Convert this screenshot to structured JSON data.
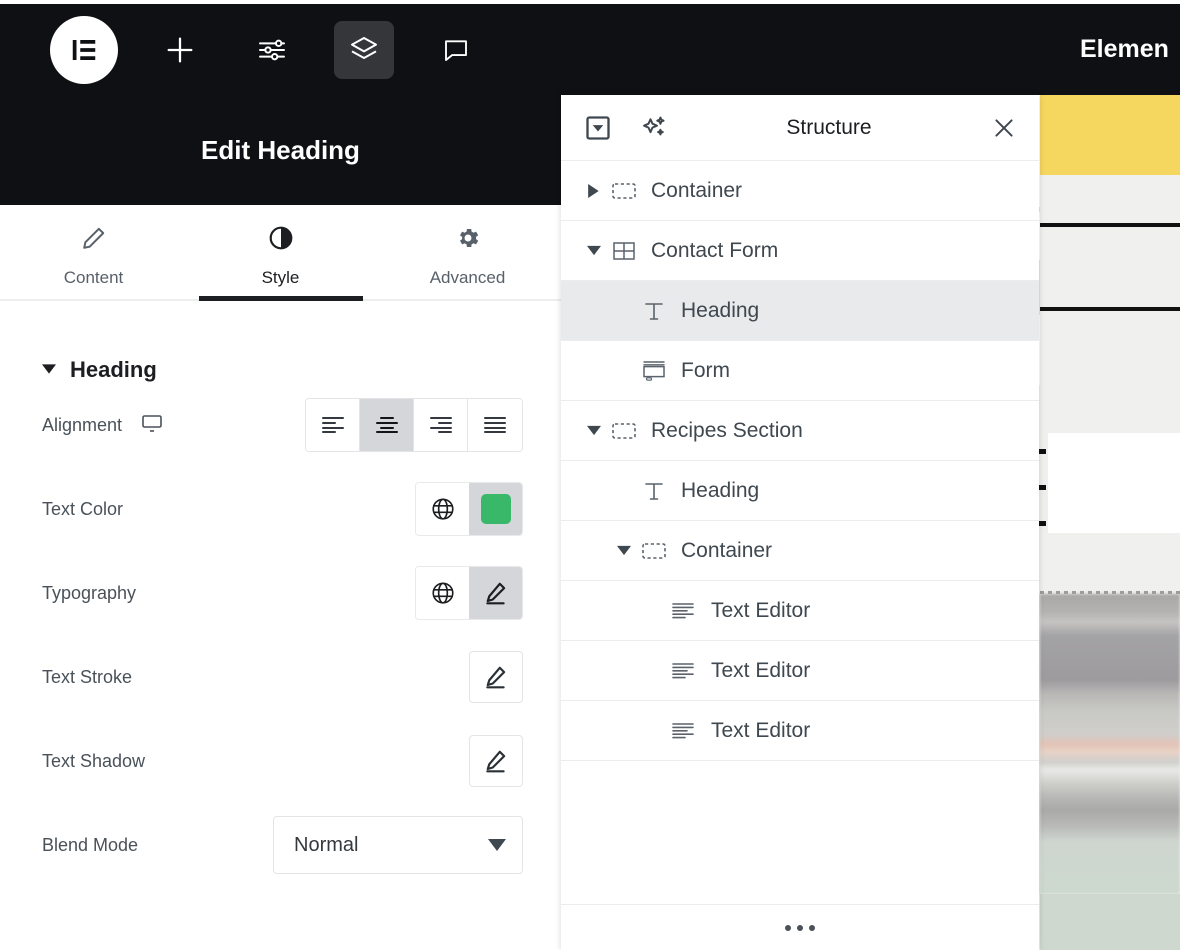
{
  "app": {
    "brand": "Elementor",
    "topbar_title": "Elemen"
  },
  "topbar": {
    "logo_icon": "elementor-logo-icon",
    "buttons": [
      {
        "name": "add-element-button",
        "icon": "plus-icon",
        "label": "Add Element",
        "active": false
      },
      {
        "name": "site-settings-button",
        "icon": "sliders-icon",
        "label": "Site Settings",
        "active": false
      },
      {
        "name": "structure-button",
        "icon": "layers-icon",
        "label": "Structure",
        "active": true
      },
      {
        "name": "notes-button",
        "icon": "comment-icon",
        "label": "Notes",
        "active": false
      }
    ]
  },
  "left_panel": {
    "header_title": "Edit Heading",
    "tabs": [
      {
        "label": "Content",
        "icon": "pencil-icon",
        "active": false
      },
      {
        "label": "Style",
        "icon": "contrast-icon",
        "active": true
      },
      {
        "label": "Advanced",
        "icon": "gear-icon",
        "active": false
      }
    ],
    "section": {
      "title": "Heading",
      "collapsed": false,
      "toggle_icon": "caret-down-icon"
    },
    "controls": {
      "alignment": {
        "label": "Alignment",
        "device_icon": "desktop-icon",
        "options": [
          {
            "value": "left",
            "icon": "align-left-icon",
            "active": false
          },
          {
            "value": "center",
            "icon": "align-center-icon",
            "active": true
          },
          {
            "value": "right",
            "icon": "align-right-icon",
            "active": false
          },
          {
            "value": "justify",
            "icon": "align-justify-icon",
            "active": false
          }
        ]
      },
      "text_color": {
        "label": "Text Color",
        "global_icon": "globe-icon",
        "swatch_color": "#3ab86a"
      },
      "typography": {
        "label": "Typography",
        "global_icon": "globe-icon",
        "edit_icon": "pencil-icon"
      },
      "text_stroke": {
        "label": "Text Stroke",
        "edit_icon": "pencil-icon"
      },
      "text_shadow": {
        "label": "Text Shadow",
        "edit_icon": "pencil-icon"
      },
      "blend_mode": {
        "label": "Blend Mode",
        "value": "Normal",
        "caret_icon": "caret-down-icon"
      }
    }
  },
  "structure_panel": {
    "title": "Structure",
    "header_icons": {
      "dropdown": "boxed-caret-down-icon",
      "ai": "sparkles-icon",
      "close": "close-icon"
    },
    "footer_handle_icon": "drag-dots-icon",
    "tree": [
      {
        "label": "Container",
        "icon": "container-icon",
        "indent": 0,
        "arrow": "collapsed",
        "selected": false
      },
      {
        "label": "Contact Form",
        "icon": "grid-icon",
        "indent": 0,
        "arrow": "expanded",
        "selected": false
      },
      {
        "label": "Heading",
        "icon": "heading-icon",
        "indent": 1,
        "arrow": "none",
        "selected": true
      },
      {
        "label": "Form",
        "icon": "form-icon",
        "indent": 1,
        "arrow": "none",
        "selected": false
      },
      {
        "label": "Recipes Section",
        "icon": "container-icon",
        "indent": 0,
        "arrow": "expanded",
        "selected": false
      },
      {
        "label": "Heading",
        "icon": "heading-icon",
        "indent": 1,
        "arrow": "none",
        "selected": false
      },
      {
        "label": "Container",
        "icon": "container-icon",
        "indent": 1,
        "arrow": "expanded",
        "selected": false
      },
      {
        "label": "Text Editor",
        "icon": "text-editor-icon",
        "indent": 2,
        "arrow": "none",
        "selected": false
      },
      {
        "label": "Text Editor",
        "icon": "text-editor-icon",
        "indent": 2,
        "arrow": "none",
        "selected": false
      },
      {
        "label": "Text Editor",
        "icon": "text-editor-icon",
        "indent": 2,
        "arrow": "none",
        "selected": false
      }
    ]
  },
  "canvas": {
    "accent_yellow": "#f5d65e",
    "page_background": "#efefed"
  }
}
